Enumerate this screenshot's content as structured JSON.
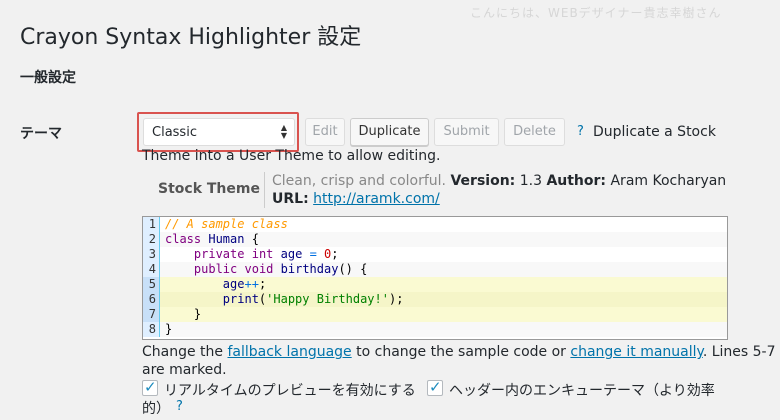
{
  "header": {
    "faded_text": "こんにちは、WEBデザイナー貴志幸樹さん",
    "title": "Crayon Syntax Highlighter 設定",
    "section": "一般設定"
  },
  "theme_row": {
    "label": "テーマ",
    "select_value": "Classic",
    "buttons": {
      "edit": "Edit",
      "duplicate": "Duplicate",
      "submit": "Submit",
      "delete": "Delete"
    },
    "help_icon": "?",
    "help_text_1": "Duplicate a Stock",
    "help_text_2": "Theme into a User Theme to allow editing."
  },
  "theme_info": {
    "label": "Stock Theme",
    "description": "Clean, crisp and colorful.",
    "version_key": "Version:",
    "version_value": "1.3",
    "author_key": "Author:",
    "author_value": "Aram Kocharyan",
    "url_key": "URL:",
    "url_value": "http://aramk.com/"
  },
  "code_sample": {
    "lines": [
      {
        "n": "1"
      },
      {
        "n": "2"
      },
      {
        "n": "3"
      },
      {
        "n": "4"
      },
      {
        "n": "5"
      },
      {
        "n": "6"
      },
      {
        "n": "7"
      },
      {
        "n": "8"
      }
    ],
    "tokens": {
      "l1": "// A sample class",
      "l2_kw": "class",
      "l2_name": "Human",
      "l2_brace": "{",
      "l3_kw1": "private",
      "l3_kw2": "int",
      "l3_id": "age",
      "l3_op": "=",
      "l3_num": "0",
      "l3_end": ";",
      "l4_kw1": "public",
      "l4_kw2": "void",
      "l4_fn": "birthday",
      "l4_end": "() {",
      "l5_id": "age",
      "l5_op": "++",
      "l5_end": ";",
      "l6_fn": "print",
      "l6_open": "(",
      "l6_str": "'Happy Birthday!'",
      "l6_end": ");",
      "l7": "}",
      "l8": "}"
    }
  },
  "note": {
    "prefix": "Change the ",
    "link1": "fallback language",
    "middle": " to change the sample code or ",
    "link2": "change it manually",
    "suffix": ". Lines 5-7",
    "line2": "are marked."
  },
  "options": {
    "live_preview_label": "リアルタイムのプレビューを有効にする",
    "enqueue_label_1": "ヘッダー内のエンキューテーマ（より効率",
    "enqueue_label_2": "的）",
    "help_icon": "?"
  }
}
